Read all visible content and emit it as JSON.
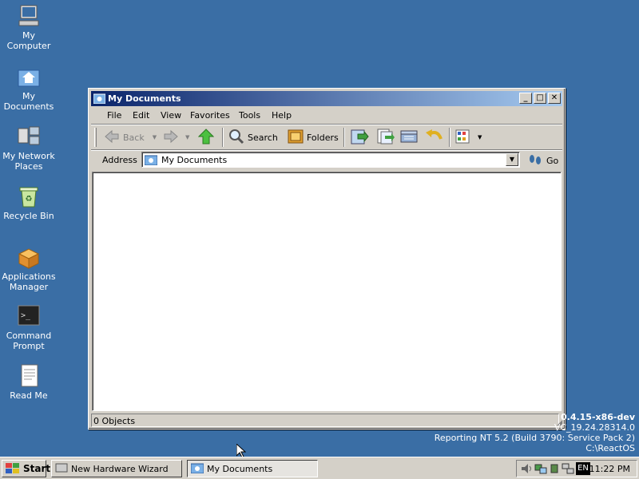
{
  "desktop": {
    "icons": [
      {
        "label": "My Computer",
        "icon": "computer-icon"
      },
      {
        "label": "My Documents",
        "icon": "documents-folder-icon"
      },
      {
        "label": "My Network Places",
        "icon": "network-icon"
      },
      {
        "label": "Recycle Bin",
        "icon": "recycle-bin-icon"
      },
      {
        "label": "Applications Manager",
        "icon": "package-icon"
      },
      {
        "label": "Command Prompt",
        "icon": "terminal-icon"
      },
      {
        "label": "Read Me",
        "icon": "document-icon"
      }
    ]
  },
  "window": {
    "title": "My Documents",
    "menu": [
      "File",
      "Edit",
      "View",
      "Favorites",
      "Tools",
      "Help"
    ],
    "toolbar": {
      "back_label": "Back",
      "search_label": "Search",
      "folders_label": "Folders"
    },
    "address": {
      "label": "Address",
      "value": "My Documents",
      "go_label": "Go"
    },
    "status": "0 Objects"
  },
  "version": {
    "line1": "0.4.15-x86-dev",
    "line2": "VC_19.24.28314.0",
    "line3": "Reporting NT 5.2 (Build 3790: Service Pack 2)",
    "line4": "C:\\ReactOS"
  },
  "taskbar": {
    "start_label": "Start",
    "tasks": [
      {
        "label": "New Hardware Wizard",
        "active": false
      },
      {
        "label": "My Documents",
        "active": true
      }
    ],
    "language": "EN",
    "clock": "11:22 PM"
  },
  "colors": {
    "desktop": "#3A6EA5",
    "title_start": "#0A246A",
    "title_end": "#A6CAF0",
    "face": "#D4D0C8"
  }
}
